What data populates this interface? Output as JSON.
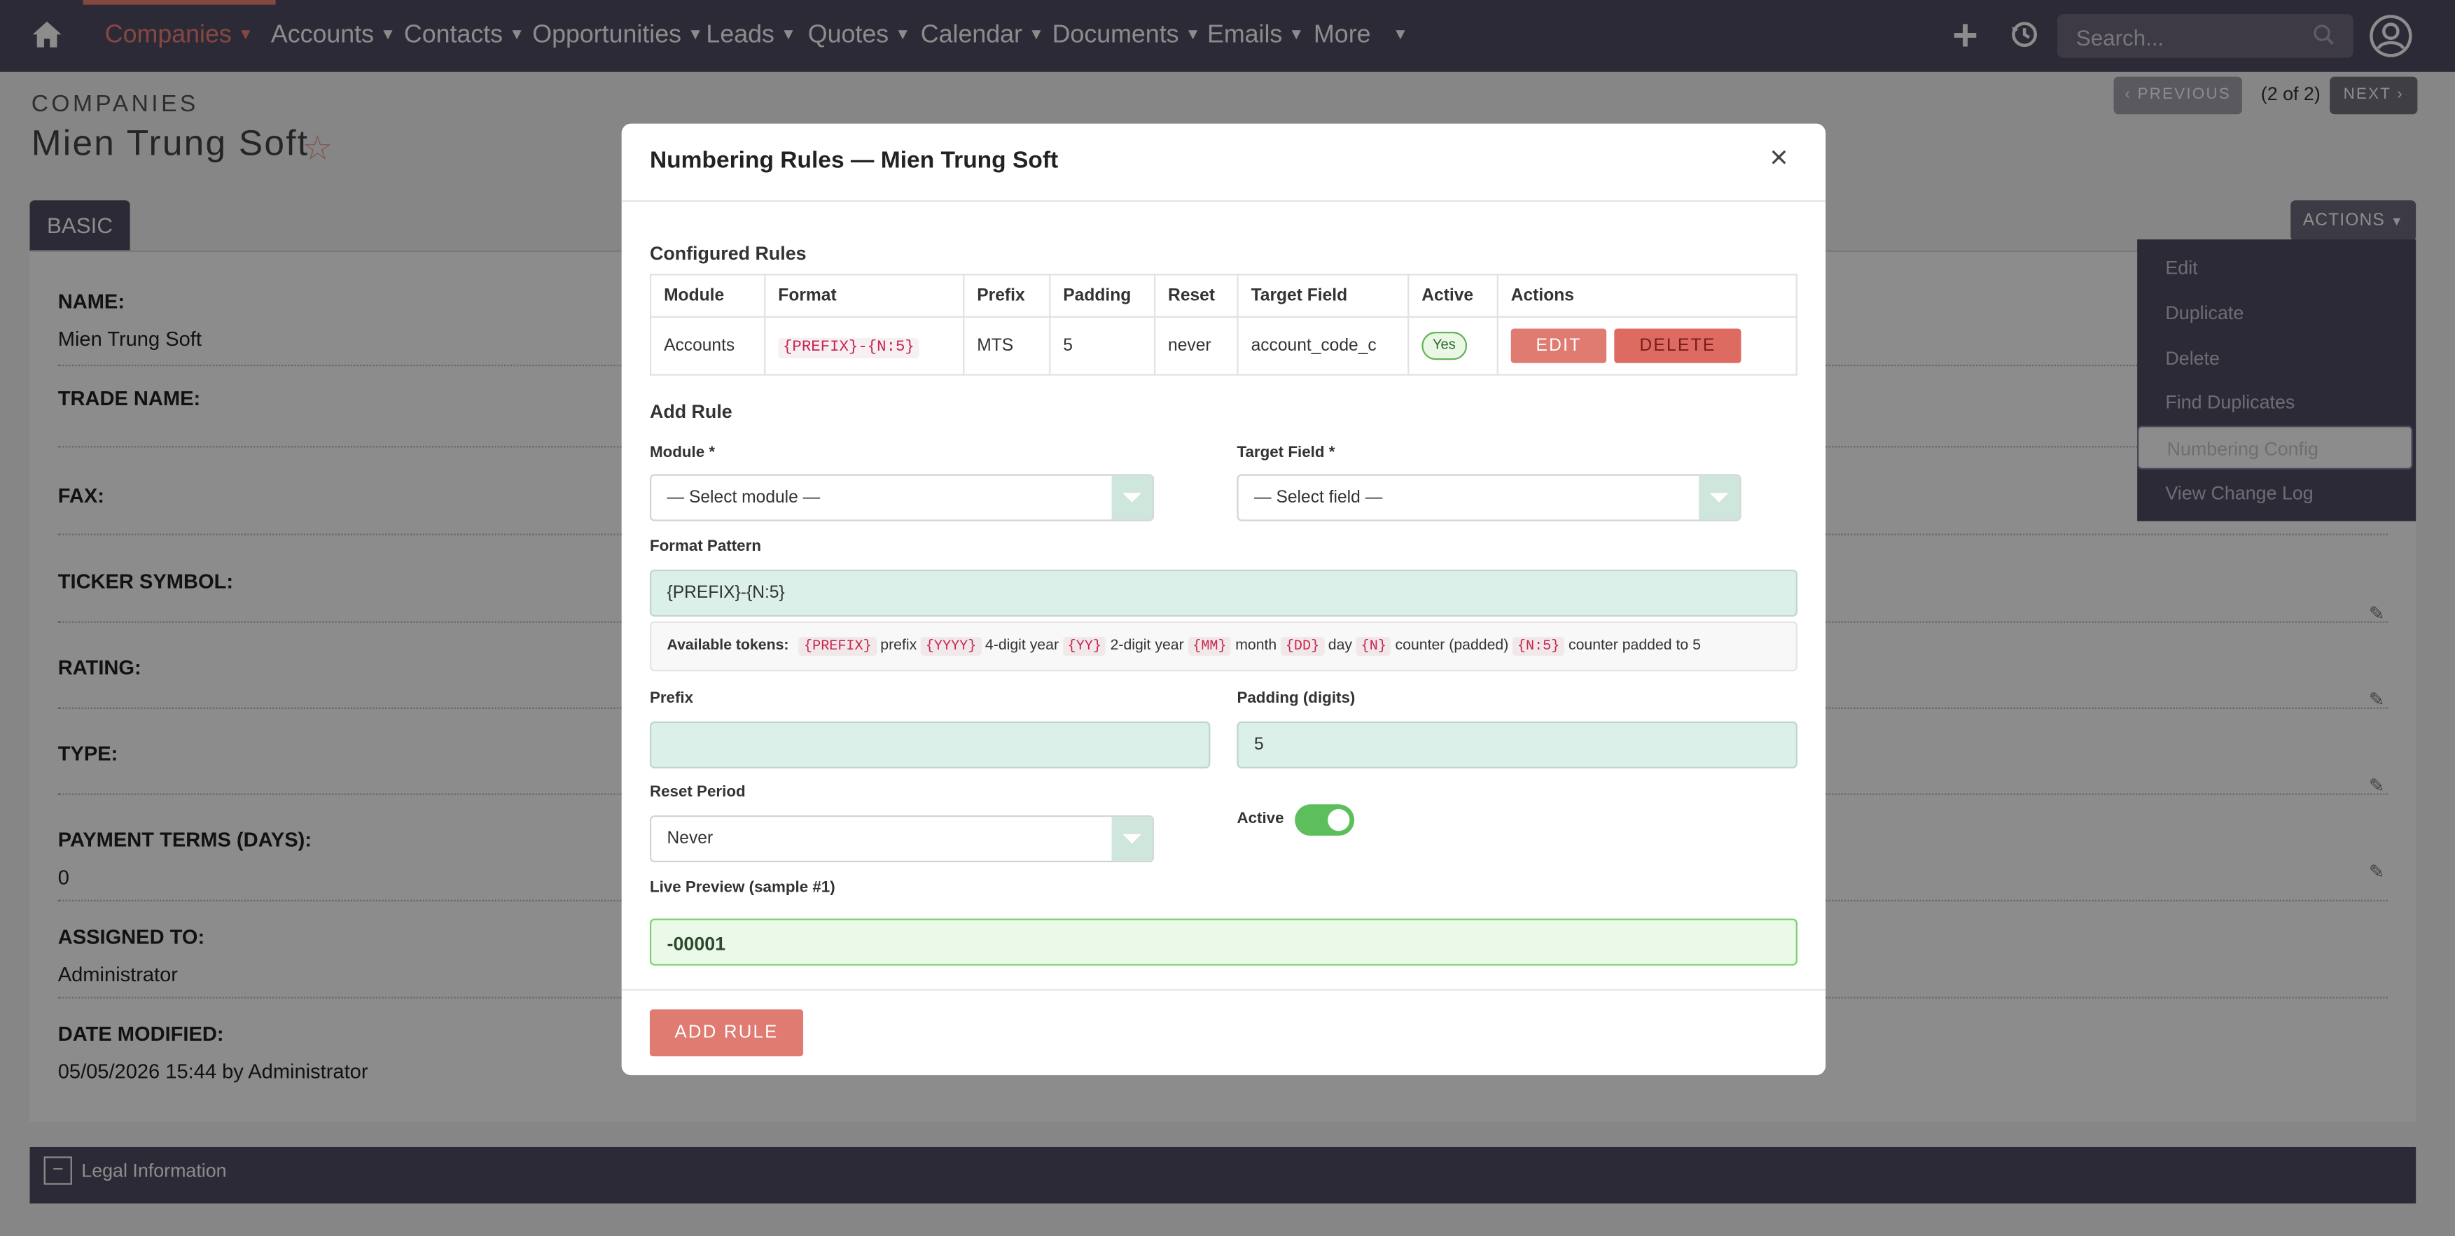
{
  "nav": {
    "items": [
      {
        "label": "Companies"
      },
      {
        "label": "Accounts"
      },
      {
        "label": "Contacts"
      },
      {
        "label": "Opportunities"
      },
      {
        "label": "Leads"
      },
      {
        "label": "Quotes"
      },
      {
        "label": "Calendar"
      },
      {
        "label": "Documents"
      },
      {
        "label": "Emails"
      },
      {
        "label": "More"
      }
    ],
    "search_placeholder": "Search...",
    "accent": "#f08377",
    "bar_color": "#534d64"
  },
  "page": {
    "breadcrumb": "COMPANIES",
    "title": "Mien Trung Soft",
    "prev_label": "PREVIOUS",
    "next_label": "NEXT",
    "pager_count": "(2 of 2)",
    "tab_basic": "BASIC",
    "actions_label": "ACTIONS",
    "fields": [
      {
        "label": "NAME:",
        "value": "Mien Trung Soft"
      },
      {
        "label": "TRADE NAME:",
        "value": ""
      },
      {
        "label": "FAX:",
        "value": ""
      },
      {
        "label": "TICKER SYMBOL:",
        "value": ""
      },
      {
        "label": "RATING:",
        "value": ""
      },
      {
        "label": "TYPE:",
        "value": ""
      },
      {
        "label": "PAYMENT TERMS (DAYS):",
        "value": "0"
      },
      {
        "label": "ASSIGNED TO:",
        "value": "Administrator"
      },
      {
        "label": "DATE MODIFIED:",
        "value": "05/05/2026 15:44 by Administrator"
      }
    ],
    "actions_menu": [
      "Edit",
      "Duplicate",
      "Delete",
      "Find Duplicates",
      "Numbering Config",
      "View Change Log"
    ],
    "legal_section": "Legal Information",
    "legal_toggle": "−"
  },
  "modal": {
    "title": "Numbering Rules — Mien Trung Soft",
    "close": "×",
    "configured_title": "Configured Rules",
    "columns": [
      "Module",
      "Format",
      "Prefix",
      "Padding",
      "Reset",
      "Target Field",
      "Active",
      "Actions"
    ],
    "rows": [
      {
        "module": "Accounts",
        "format": "{PREFIX}-{N:5}",
        "prefix": "MTS",
        "padding": "5",
        "reset": "never",
        "target_field": "account_code_c",
        "active": "Yes",
        "edit": "EDIT",
        "delete": "DELETE"
      }
    ],
    "add_title": "Add Rule",
    "module_label": "Module *",
    "module_value": "— Select module —",
    "target_label": "Target Field *",
    "target_value": "— Select field —",
    "format_label": "Format Pattern",
    "format_value": "{PREFIX}-{N:5}",
    "tokens_label": "Available tokens:",
    "tokens": [
      {
        "code": "{PREFIX}",
        "desc": "prefix"
      },
      {
        "code": "{YYYY}",
        "desc": "4-digit year"
      },
      {
        "code": "{YY}",
        "desc": "2-digit year"
      },
      {
        "code": "{MM}",
        "desc": "month"
      },
      {
        "code": "{DD}",
        "desc": "day"
      },
      {
        "code": "{N}",
        "desc": "counter (padded)"
      },
      {
        "code": "{N:5}",
        "desc": "counter padded to 5"
      }
    ],
    "prefix_label": "Prefix",
    "prefix_value": "",
    "padding_label": "Padding (digits)",
    "padding_value": "5",
    "reset_label": "Reset Period",
    "reset_value": "Never",
    "active_label": "Active",
    "active_on": true,
    "preview_label": "Live Preview (sample #1)",
    "preview_value": "-00001",
    "add_button": "ADD RULE"
  }
}
